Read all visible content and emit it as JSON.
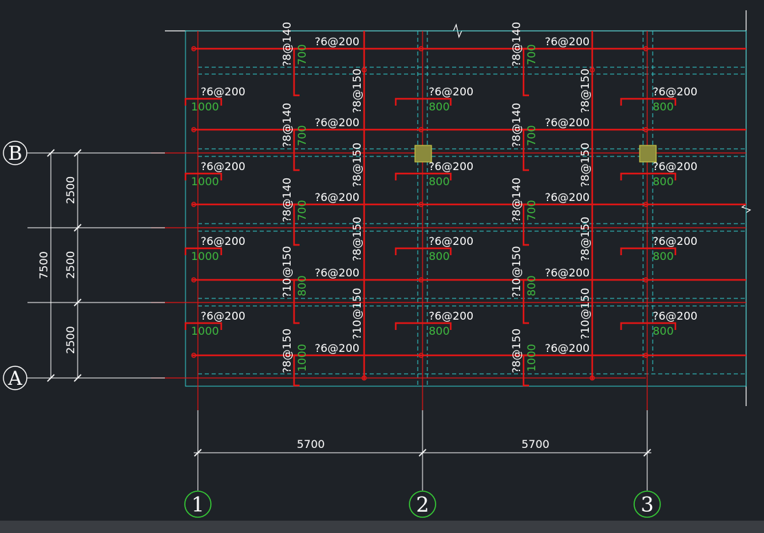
{
  "colors": {
    "background": "#1e2227",
    "rebar": "#e01616",
    "dim_line": "#ffffff",
    "text": "#ffffff",
    "length_text": "#3fb93f",
    "dashed": "#33cccc",
    "grid_bubble": "#36c936",
    "column": "#8a8a3c",
    "column_border": "#c8c848"
  },
  "grid_axes": {
    "rows": [
      {
        "label": "B"
      },
      {
        "label": "A"
      }
    ],
    "cols": [
      {
        "label": "1"
      },
      {
        "label": "2"
      },
      {
        "label": "3"
      }
    ]
  },
  "dimensions": {
    "horizontal": [
      "5700",
      "5700"
    ],
    "vertical_segments": [
      "2500",
      "2500",
      "2500"
    ],
    "vertical_total": "7500"
  },
  "bottom_bar_labels": [
    "?6@200",
    "?6@200",
    "?6@200",
    "?6@200",
    "?6@200",
    "?6@200",
    "?6@200",
    "?6@200",
    "?6@200",
    "?6@200"
  ],
  "top_bar_labels": [
    "?6@200",
    "?6@200",
    "?6@200",
    "?6@200",
    "?6@200",
    "?6@200",
    "?6@200",
    "?6@200",
    "?6@200",
    "?6@200",
    "?6@200",
    "?6@200"
  ],
  "top_bar_lengths": [
    "1000",
    "800",
    "800",
    "1000",
    "800",
    "800",
    "1000",
    "800",
    "800",
    "1000",
    "800",
    "800"
  ],
  "left_support_bars": [
    {
      "label": "?8@140",
      "length": "700"
    },
    {
      "label": "?8@140",
      "length": "700"
    },
    {
      "label": "?8@140",
      "length": "700"
    },
    {
      "label": "?10@150",
      "length": "800"
    },
    {
      "label": "?8@150",
      "length": "1000"
    },
    {
      "label": "?8@140",
      "length": "700"
    },
    {
      "label": "?8@140",
      "length": "700"
    },
    {
      "label": "?8@140",
      "length": "700"
    },
    {
      "label": "?10@150",
      "length": "800"
    },
    {
      "label": "?8@150",
      "length": "1000"
    }
  ],
  "mid_vertical_bars": [
    "?8@150",
    "?8@150",
    "?8@150",
    "?10@150",
    "?8@150",
    "?8@150",
    "?8@150",
    "?10@150"
  ]
}
